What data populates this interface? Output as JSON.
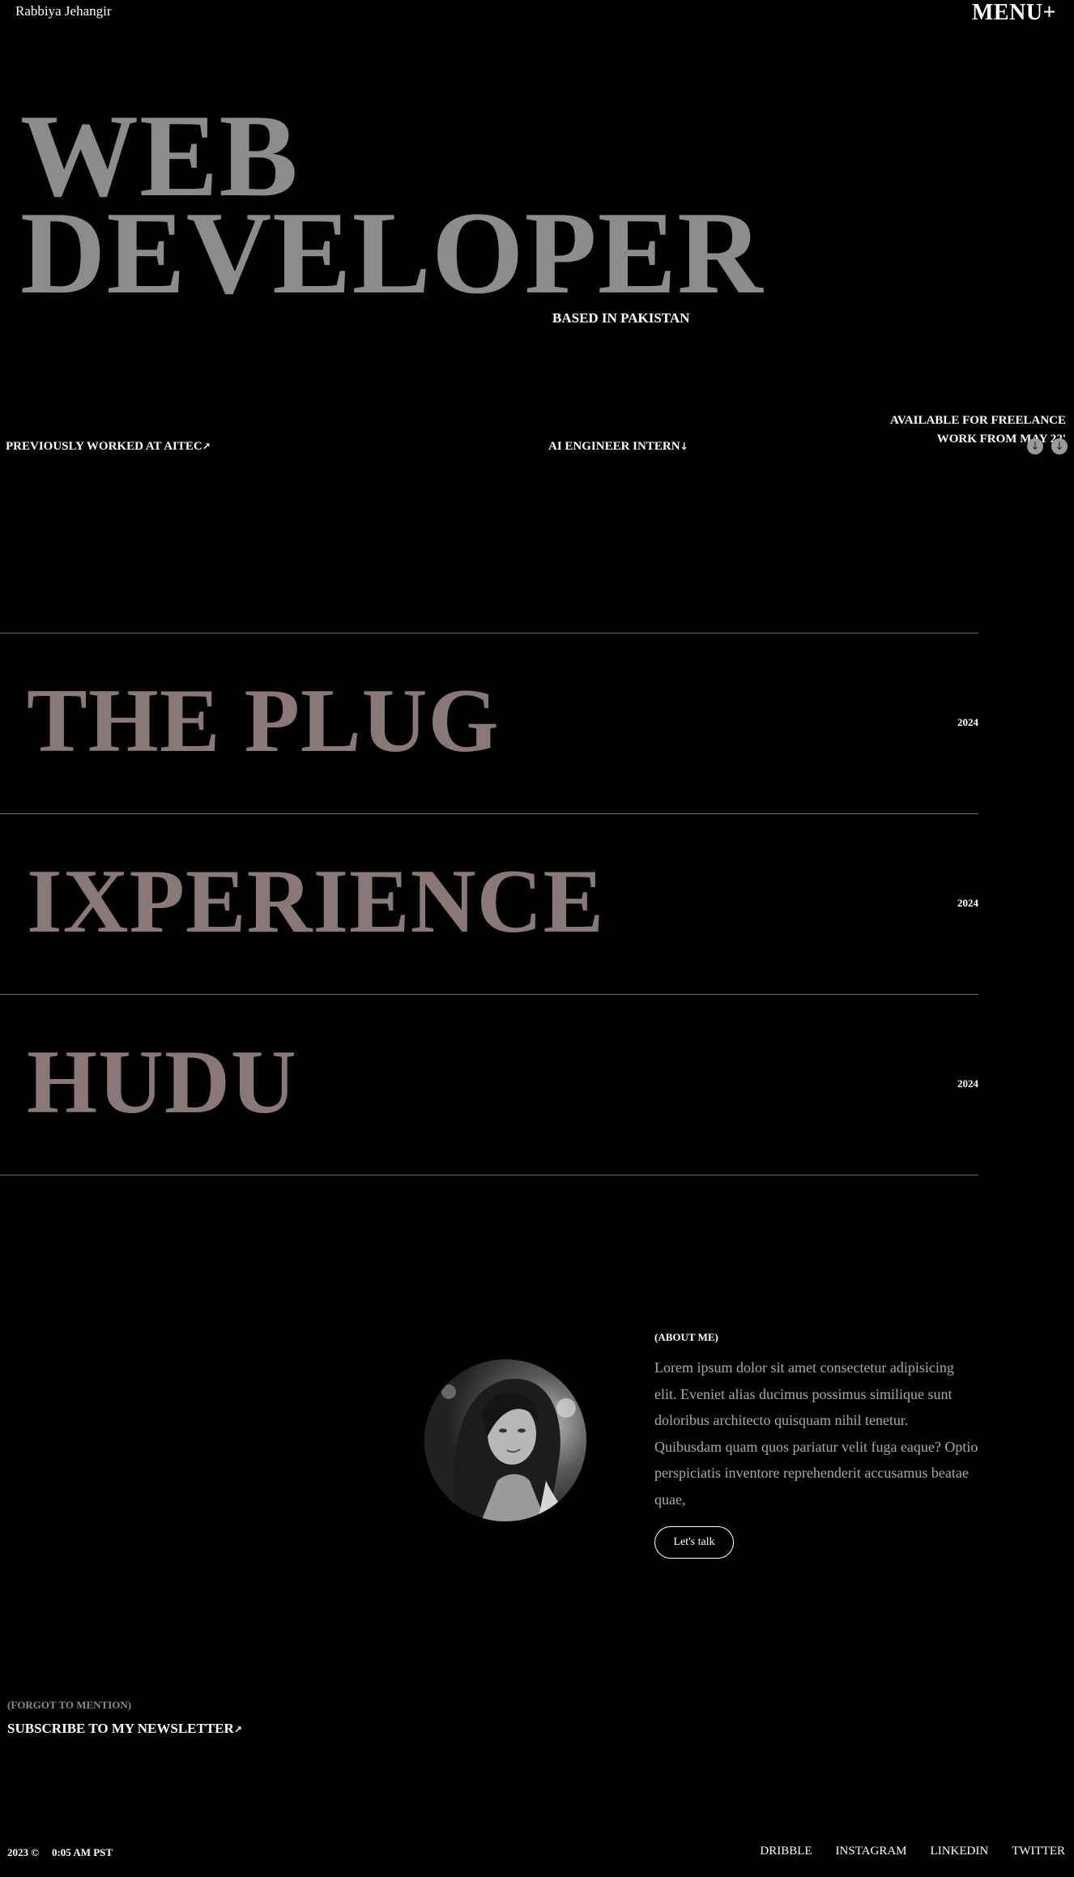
{
  "header": {
    "brand": "Rabbiya Jehangir",
    "menu_label": "MENU+"
  },
  "hero": {
    "title_line1": "WEB",
    "title_line2": "DEVELOPER",
    "location": "BASED IN PAKISTAN",
    "availability_line1": "AVAILABLE FOR FREELANCE",
    "availability_line2": "WORK FROM MAY 22'",
    "previous_work": "PREVIOUSLY WORKED AT AITEC",
    "role": "AI ENGINEER INTERN"
  },
  "projects": [
    {
      "name": "THE PLUG",
      "year": "2024"
    },
    {
      "name": "IXPERIENCE",
      "year": "2024"
    },
    {
      "name": "HUDU",
      "year": "2024"
    }
  ],
  "about": {
    "label": "(ABOUT ME)",
    "text": "Lorem ipsum dolor sit amet consectetur adipisicing elit. Eveniet alias ducimus possimus similique sunt doloribus architecto quisquam nihil tenetur. Quibusdam quam quos pariatur velit fuga eaque? Optio perspiciatis inventore reprehenderit accusamus beatae quae,",
    "button_label": "Let's talk"
  },
  "newsletter": {
    "label": "(FORGOT TO MENTION)",
    "cta": "SUBSCRIBE TO MY NEWSLETTER"
  },
  "footer": {
    "copyright": "2023 ©",
    "time": "0:05 AM PST",
    "links": [
      "DRIBBLE",
      "INSTAGRAM",
      "LINKEDIN",
      "TWITTER"
    ]
  },
  "icons": {
    "arrow_up_right": "↗",
    "arrow_down": "↓"
  }
}
